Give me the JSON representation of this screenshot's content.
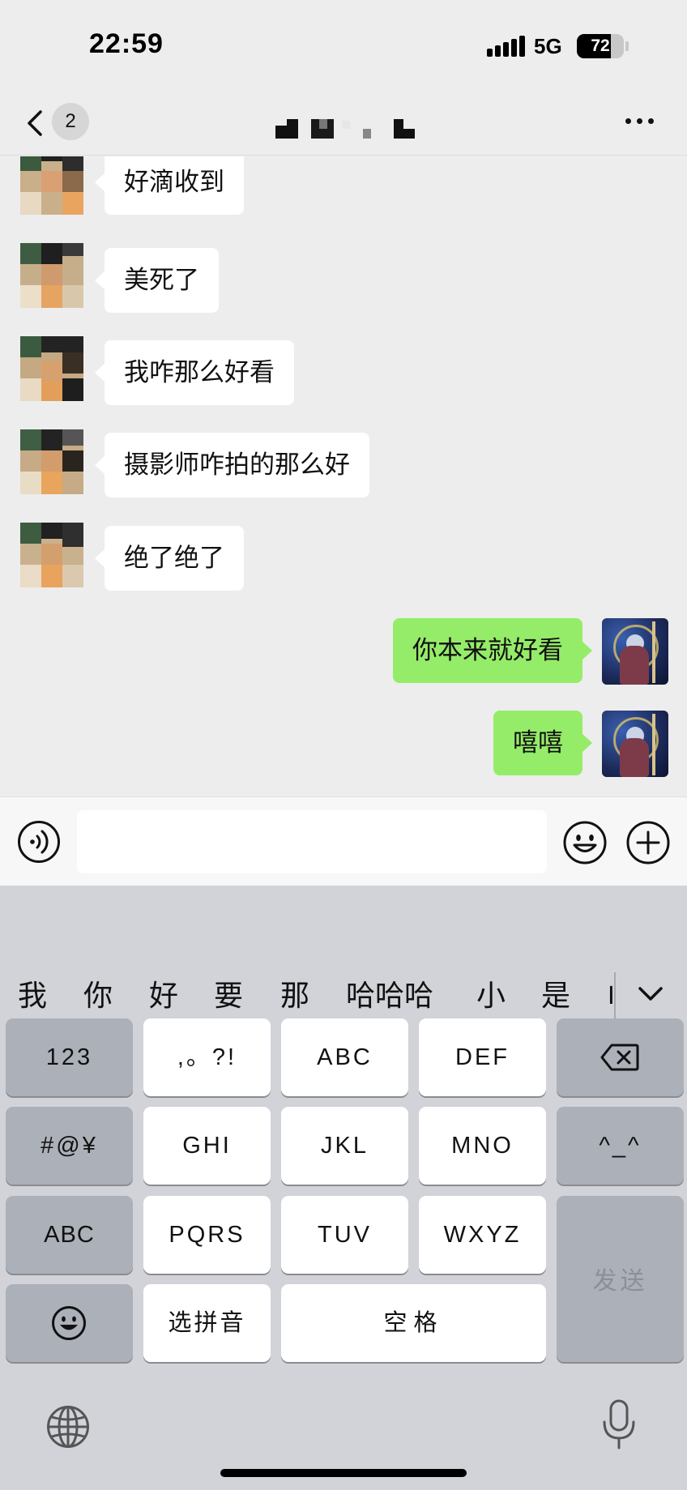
{
  "status_bar": {
    "time": "22:59",
    "network": "5G",
    "battery": "72",
    "battery_level": 0.72
  },
  "nav": {
    "unread_count": "2"
  },
  "messages": [
    {
      "sender": "other",
      "text": "好滴收到"
    },
    {
      "sender": "other",
      "text": "美死了"
    },
    {
      "sender": "other",
      "text": "我咋那么好看"
    },
    {
      "sender": "other",
      "text": "摄影师咋拍的那么好"
    },
    {
      "sender": "other",
      "text": "绝了绝了"
    },
    {
      "sender": "self",
      "text": "你本来就好看"
    },
    {
      "sender": "self",
      "text": "嘻嘻"
    }
  ],
  "input": {
    "value": ""
  },
  "keyboard": {
    "candidates": [
      "我",
      "你",
      "好",
      "要",
      "那",
      "哈哈哈",
      "小",
      "是",
      "I"
    ],
    "keys": {
      "num": "123",
      "punct": ",。?!",
      "abc2": "ABC",
      "def3": "DEF",
      "symbols": "#@¥",
      "ghi4": "GHI",
      "jkl5": "JKL",
      "mno6": "MNO",
      "kaomoji": "^_^",
      "abc_switch": "ABC",
      "pqrs7": "PQRS",
      "tuv8": "TUV",
      "wxyz9": "WXYZ",
      "send": "发送",
      "pinyin": "选拼音",
      "space": "空格"
    }
  }
}
